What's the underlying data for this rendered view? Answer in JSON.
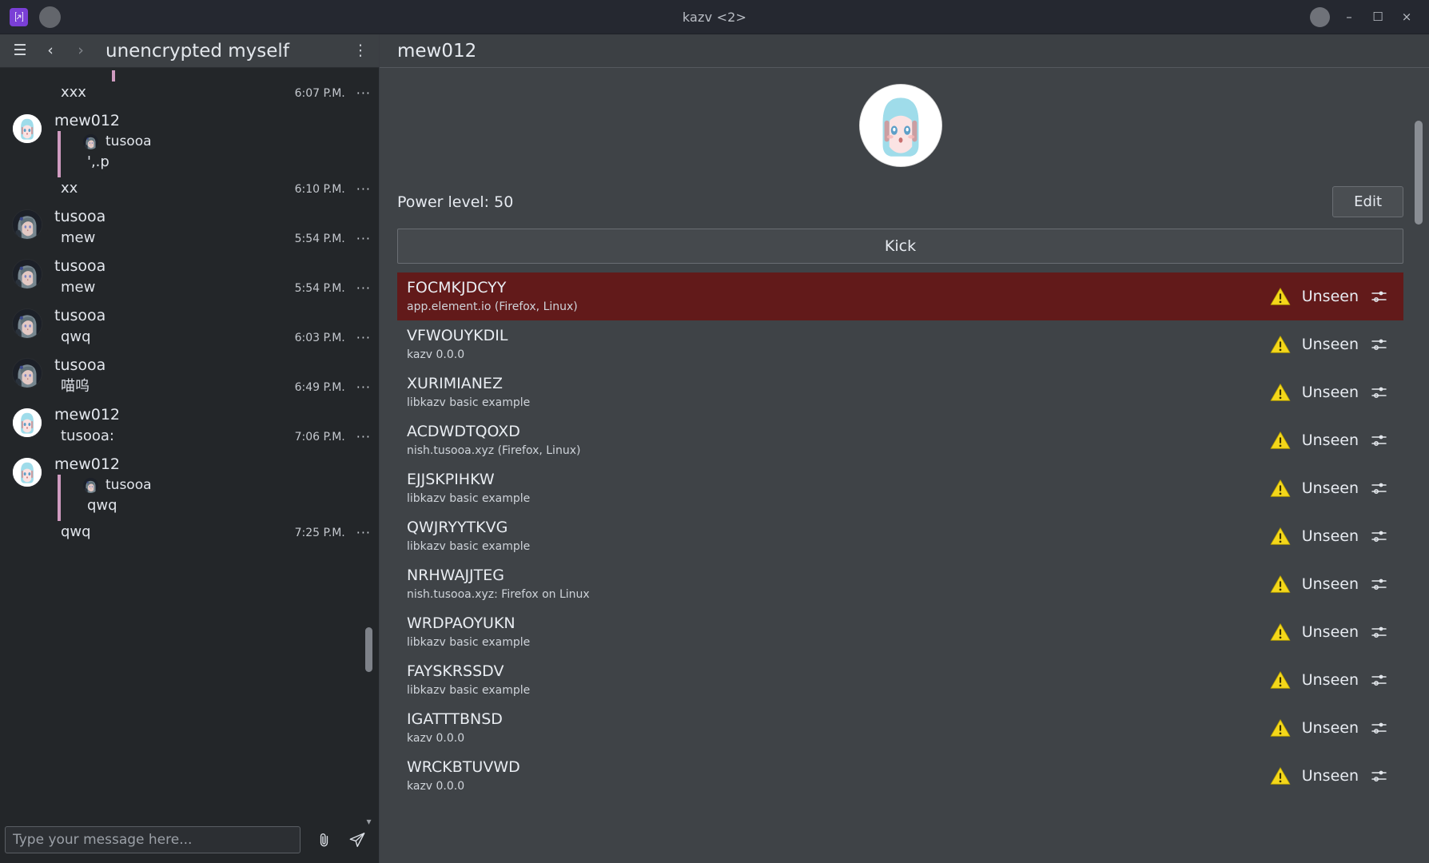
{
  "window": {
    "title": "kazv <2>",
    "minimize_label": "–",
    "maximize_label": "☐",
    "close_label": "×",
    "app_icon": "matrix-logo-icon"
  },
  "left_panel": {
    "header": {
      "menu_icon": "hamburger-menu-icon",
      "back_icon": "chevron-left-icon",
      "forward_icon": "chevron-right-icon",
      "title": "unencrypted myself",
      "kebab_icon": "more-vertical-icon"
    },
    "messages": [
      {
        "type": "stub",
        "show_avatar": false,
        "sender": "",
        "text": "xxx",
        "time": "6:07 P.M.",
        "dots": "···",
        "avatar": "",
        "quote": null
      },
      {
        "type": "reply",
        "show_avatar": true,
        "sender": "mew012",
        "avatar": "mew",
        "quote": {
          "sender": "tusooa",
          "avatar": "tusooa",
          "body": "',.p"
        },
        "text": "xx",
        "time": "6:10 P.M.",
        "dots": "···"
      },
      {
        "type": "plain",
        "show_avatar": true,
        "sender": "tusooa",
        "avatar": "tusooa",
        "text": "mew",
        "time": "5:54 P.M.",
        "dots": "···",
        "quote": null
      },
      {
        "type": "plain",
        "show_avatar": true,
        "sender": "tusooa",
        "avatar": "tusooa",
        "text": "mew",
        "time": "5:54 P.M.",
        "dots": "···",
        "quote": null
      },
      {
        "type": "plain",
        "show_avatar": true,
        "sender": "tusooa",
        "avatar": "tusooa",
        "text": "qwq",
        "time": "6:03 P.M.",
        "dots": "···",
        "quote": null
      },
      {
        "type": "plain",
        "show_avatar": true,
        "sender": "tusooa",
        "avatar": "tusooa",
        "text": "喵呜",
        "time": "6:49 P.M.",
        "dots": "···",
        "quote": null
      },
      {
        "type": "plain",
        "show_avatar": true,
        "sender": "mew012",
        "avatar": "mew",
        "text": "tusooa:",
        "time": "7:06 P.M.",
        "dots": "···",
        "quote": null
      },
      {
        "type": "reply",
        "show_avatar": true,
        "sender": "mew012",
        "avatar": "mew",
        "quote": {
          "sender": "tusooa",
          "avatar": "tusooa",
          "body": "qwq"
        },
        "text": "qwq",
        "time": "7:25 P.M.",
        "dots": "···"
      }
    ],
    "compose": {
      "placeholder": "Type your message here...",
      "value": "",
      "attach_icon": "paperclip-icon",
      "send_icon": "send-plane-icon"
    }
  },
  "right_panel": {
    "header_title": "mew012",
    "avatar": "mew",
    "power_level_label": "Power level: 50",
    "edit_label": "Edit",
    "kick_label": "Kick",
    "devices": [
      {
        "id": "FOCMKJDCYY",
        "desc": "app.element.io (Firefox, Linux)",
        "status": "Unseen",
        "selected": true
      },
      {
        "id": "VFWOUYKDIL",
        "desc": "kazv 0.0.0",
        "status": "Unseen",
        "selected": false
      },
      {
        "id": "XURIMIANEZ",
        "desc": "libkazv basic example",
        "status": "Unseen",
        "selected": false
      },
      {
        "id": "ACDWDTQOXD",
        "desc": "nish.tusooa.xyz (Firefox, Linux)",
        "status": "Unseen",
        "selected": false
      },
      {
        "id": "EJJSKPIHKW",
        "desc": "libkazv basic example",
        "status": "Unseen",
        "selected": false
      },
      {
        "id": "QWJRYYTKVG",
        "desc": "libkazv basic example",
        "status": "Unseen",
        "selected": false
      },
      {
        "id": "NRHWAJJTEG",
        "desc": "nish.tusooa.xyz: Firefox on Linux",
        "status": "Unseen",
        "selected": false
      },
      {
        "id": "WRDPAOYUKN",
        "desc": "libkazv basic example",
        "status": "Unseen",
        "selected": false
      },
      {
        "id": "FAYSKRSSDV",
        "desc": "libkazv basic example",
        "status": "Unseen",
        "selected": false
      },
      {
        "id": "IGATTTBNSD",
        "desc": "kazv 0.0.0",
        "status": "Unseen",
        "selected": false
      },
      {
        "id": "WRCKBTUVWD",
        "desc": "kazv 0.0.0",
        "status": "Unseen",
        "selected": false
      }
    ],
    "warn_icon": "warning-triangle-icon",
    "settings_icon": "sliders-icon"
  },
  "colors": {
    "selected_device": "#621a1a",
    "warning": "#f4d71a",
    "quote_bar": "#cf9bc0",
    "accent": "#7a3fd6"
  }
}
